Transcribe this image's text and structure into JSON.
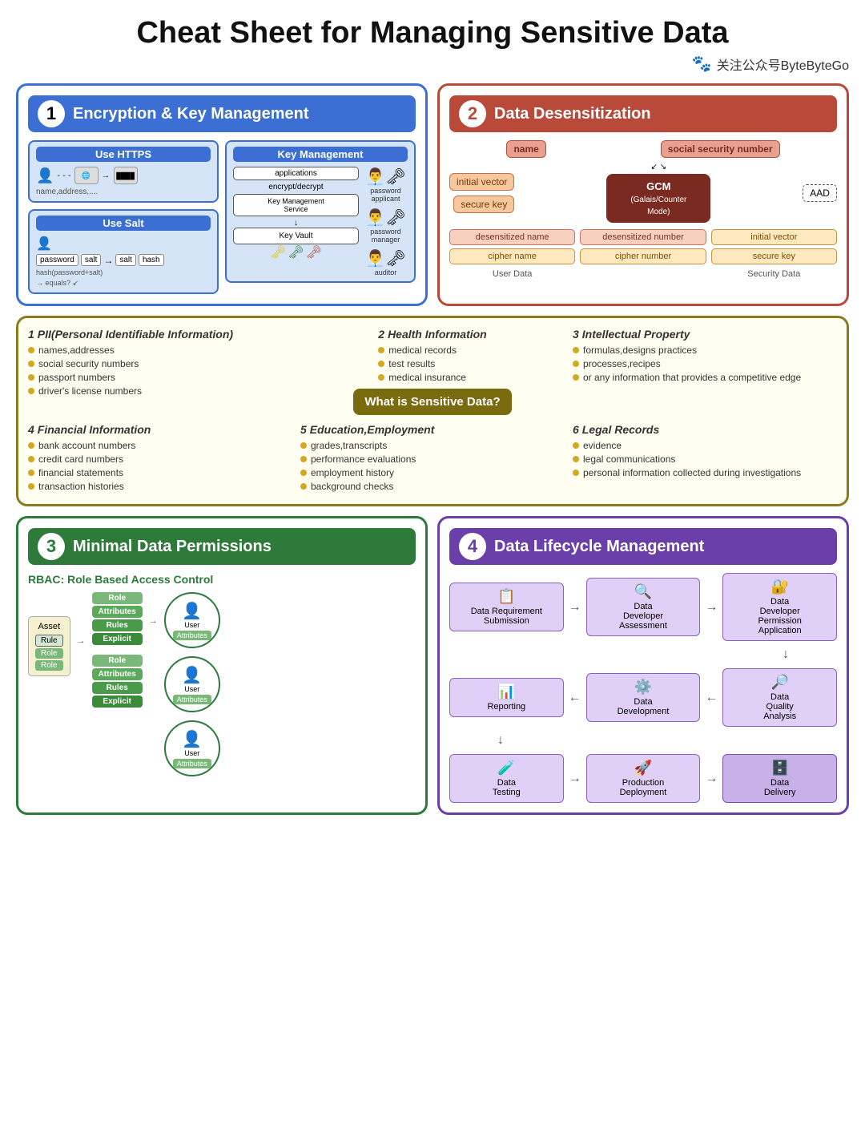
{
  "page": {
    "title": "Cheat Sheet for Managing Sensitive Data",
    "brand": "关注公众号ByteByteGo"
  },
  "section1": {
    "number": "1",
    "title": "Encryption & Key Management",
    "https_label": "Use HTTPS",
    "salt_label": "Use Salt",
    "km_label": "Key Management",
    "applications": "applications",
    "encrypt_decrypt": "encrypt/decrypt",
    "kms_label": "Key Management\nService",
    "key_vault": "Key Vault",
    "password_applicant": "password\napplicant",
    "password_manager": "password\nmanager",
    "auditor": "auditor",
    "name_address": "name,address,....",
    "password": "password",
    "salt": "salt",
    "hash": "hash",
    "hash_formula": "hash(password+salt)",
    "equals": "→ equals? ↙"
  },
  "section2": {
    "number": "2",
    "title": "Data Desensitization",
    "gcm_label": "GCM\n(Galais/Counter\nMode)",
    "inputs": {
      "name": "name",
      "social_security": "social security\nnumber",
      "initial_vector": "initial vector",
      "secure_key": "secure key",
      "aad": "AAD"
    },
    "outputs": {
      "desensitized_name": "desensitized\nname",
      "desensitized_number": "desensitized\nnumber",
      "initial_vector_out": "initial\nvector",
      "cipher_name": "cipher name",
      "cipher_number": "cipher\nnumber",
      "secure_key_out": "secure\nkey"
    },
    "user_data_label": "User Data",
    "security_data_label": "Security Data"
  },
  "sensitive_section": {
    "what_is_label": "What is Sensitive Data?",
    "categories": [
      {
        "number": "1",
        "title": "PII(Personal Identifiable Information)",
        "items": [
          "names,addresses",
          "social security numbers",
          "passport numbers",
          "driver's license numbers"
        ]
      },
      {
        "number": "2",
        "title": "Health Information",
        "items": [
          "medical records",
          "test results",
          "medical insurance"
        ]
      },
      {
        "number": "3",
        "title": "Intellectual Property",
        "items": [
          "formulas,designs practices",
          "processes,recipes",
          "or any information that provides a competitive edge"
        ]
      },
      {
        "number": "4",
        "title": "Financial Information",
        "items": [
          "bank account numbers",
          "credit card numbers",
          "financial statements",
          "transaction histories"
        ]
      },
      {
        "number": "5",
        "title": "Education,Employment",
        "items": [
          "grades,transcripts",
          "performance evaluations",
          "employment history",
          "background checks"
        ]
      },
      {
        "number": "6",
        "title": "Legal Records",
        "items": [
          "evidence",
          "legal communications",
          "personal information collected during investigations"
        ]
      }
    ]
  },
  "section3": {
    "number": "3",
    "title": "Minimal Data Permissions",
    "rbac_label": "RBAC: Role Based Access Control",
    "asset": "Asset",
    "role_label": "Role",
    "attributes": "Attributes",
    "rules": "Rules",
    "explicit": "Explicit",
    "user": "User"
  },
  "section4": {
    "number": "4",
    "title": "Data Lifecycle Management",
    "steps": [
      "Data Requirement\nSubmission",
      "Data\nDeveloper\nAssessment",
      "Data\nDeveloper\nPermission\nApplication",
      "Reporting",
      "Data\nDevelopment",
      "Data\nQuality\nAnalysis",
      "Data\nTesting",
      "Production\nDeployment",
      "Data\nDelivery"
    ]
  }
}
